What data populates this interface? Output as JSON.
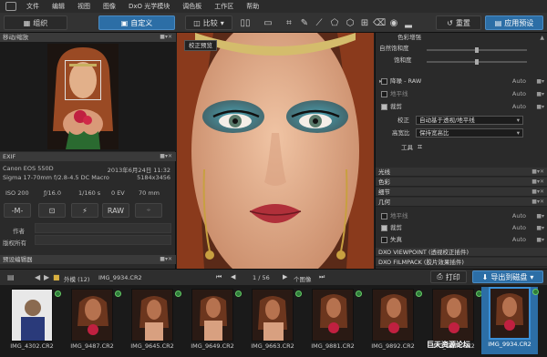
{
  "menubar": {
    "items": [
      "文件",
      "编辑",
      "视图",
      "图像",
      "DxO 光学模块",
      "调色板",
      "工作区",
      "帮助"
    ]
  },
  "toolbar": {
    "tab_organize": "组织",
    "tab_customize": "自定义",
    "compare_label": "比较",
    "reset_label": "重置",
    "apply_preset_label": "应用预设"
  },
  "left": {
    "nav_title": "移动/缩放",
    "exif_title": "EXIF",
    "camera": "Canon EOS 550D",
    "date": "2013年6月24日 11:32",
    "lens": "Sigma 17-70mm f/2.8-4.5 DC Macro",
    "dims": "5184x3456",
    "iso": "ISO 200",
    "aperture": "ƒ/16.0",
    "shutter": "1/160 s",
    "ev": "0 EV",
    "focal": "70 mm",
    "mode_m": "-M-",
    "raw": "RAW",
    "author_label": "作者",
    "copyright_label": "版权所有",
    "preset_editor": "预设编辑器"
  },
  "viewer": {
    "tooltip": "校正预览"
  },
  "right": {
    "color_enhance": "色彩增强",
    "natural_sat": "自然饱和度",
    "saturation": "饱和度",
    "denoise": "降噪 - RAW",
    "denoise_val": "Auto",
    "horizon": "地平线",
    "horizon_val": "Auto",
    "crop": "裁剪",
    "crop_val": "Auto",
    "correct_label": "校正",
    "correct_value": "自动基于透视/地平线",
    "aspect_label": "高宽比",
    "aspect_value": "保持宽高比",
    "tools_label": "工具",
    "sections": [
      "光线",
      "色彩",
      "细节",
      "几何"
    ],
    "g_horizon": "地平线",
    "g_horizon_val": "Auto",
    "g_crop": "裁剪",
    "g_crop_val": "Auto",
    "g_vignette": "失真",
    "g_vignette_val": "Auto",
    "viewpoint": "DXO VIEWPOINT (透视校正插件)",
    "filmpack": "DXO FILMPACK (胶片效果插件)"
  },
  "film": {
    "folder": "外模 (12)",
    "filename": "IMG_9934.CR2",
    "page": "1 / 56",
    "count_label": "个图像",
    "print_label": "打印",
    "export_label": "导出到磁盘",
    "thumbs": [
      "IMG_4302.CR2",
      "IMG_9487.CR2",
      "IMG_9645.CR2",
      "IMG_9649.CR2",
      "IMG_9663.CR2",
      "IMG_9881.CR2",
      "IMG_9892.CR2",
      "IMG_9934.CR2",
      "IMG_9934.CR2"
    ],
    "watermark": "巨天资源论坛"
  },
  "colors": {
    "accent": "#2c6ea6",
    "panel": "#2a2a2a",
    "select": "#3b8fd6"
  }
}
